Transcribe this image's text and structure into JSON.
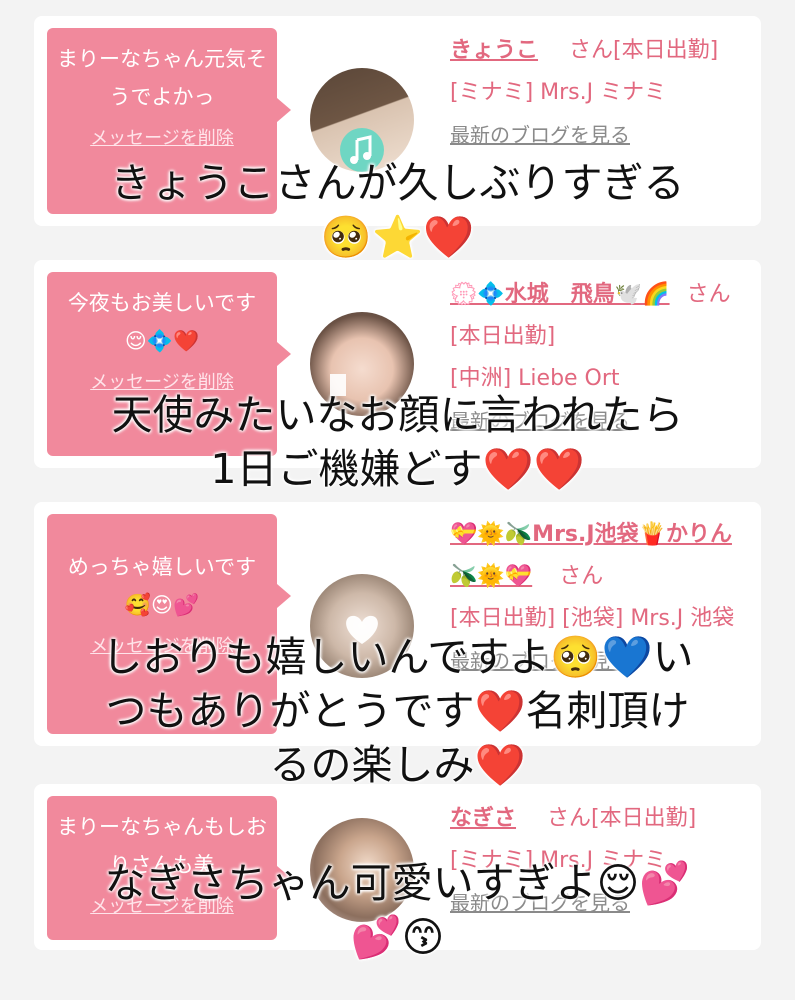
{
  "cards": [
    {
      "message": "まりーなちゃん元気そうでよかっ",
      "delete_label": "メッセージを削除",
      "name": "きょうこ",
      "suffix": "さん[本日出勤]",
      "shop": "[ミナミ] Mrs.J ミナミ",
      "blog": "最新のブログを見る"
    },
    {
      "message": "今夜もお美しいです😌💠❤️",
      "delete_label": "メッセージを削除",
      "name": "💮💠水城　飛鳥🕊️🌈",
      "suffix": "さん[本日出勤]",
      "shop": "[中洲] Liebe Ort",
      "blog": "最新のブログを見る"
    },
    {
      "message": "めっちゃ嬉しいです🥰😍💕",
      "delete_label": "メッセージを削除",
      "name": "💝🌞🫒Mrs.J池袋🍟かりん🫒🌞💝",
      "suffix": "さん",
      "shop": "[本日出勤] [池袋] Mrs.J 池袋",
      "blog": "最新のブログを見る"
    },
    {
      "message": "まりーなちゃんもしおりさんも美",
      "delete_label": "メッセージを削除",
      "name": "なぎさ",
      "suffix": "さん[本日出勤]",
      "shop": "[ミナミ] Mrs.J ミナミ",
      "blog": "最新のブログを見る"
    }
  ],
  "overlay": {
    "caption1_line1": "きょうこさんが久しぶりすぎる",
    "caption1_line2": "🥺⭐❤️",
    "caption2_line1": "天使みたいなお顔に言われたら",
    "caption2_line2": "1日ご機嫌どす❤️❤️",
    "caption3_line1": "しおりも嬉しいんですよ🥺💙い",
    "caption3_line2": "つもありがとうです❤️名刺頂け",
    "caption3_line3": "るの楽しみ❤️",
    "caption4_line1": "なぎさちゃん可愛いすぎよ😌💕",
    "caption4_line2": "💕😙"
  },
  "colors": {
    "bubble": "#f1899c",
    "link": "#e2687f",
    "background": "#f3f3f3"
  },
  "icons": {
    "avatar1": "music-note-icon",
    "avatar2": "profile-photo",
    "avatar3": "heart-sticker-icon",
    "avatar4": "profile-photo"
  }
}
